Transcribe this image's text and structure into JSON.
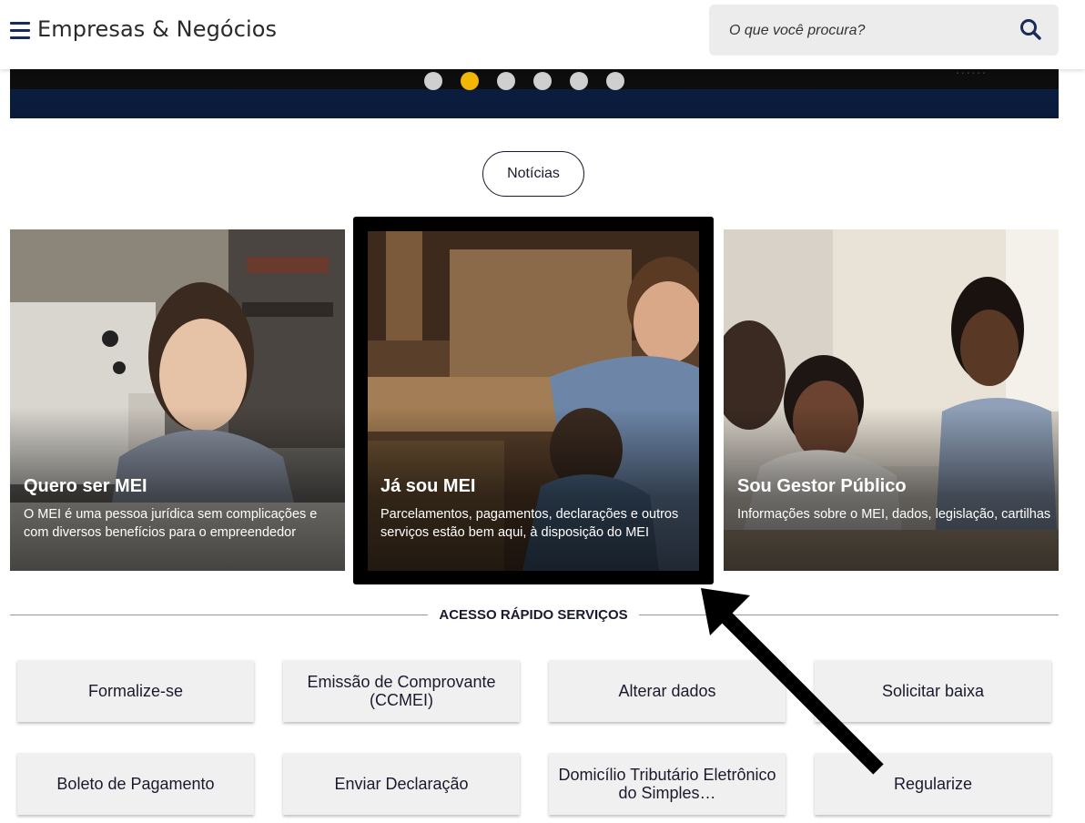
{
  "header": {
    "brand": "Empresas & Negócios",
    "search_placeholder": "O que você procura?"
  },
  "carousel": {
    "slide_count": 6,
    "active_index": 1
  },
  "news_button": "Notícias",
  "cards": [
    {
      "title": "Quero ser MEI",
      "desc": "O MEI é uma pessoa jurídica sem complicações e com diversos benefícios para o empreendedor"
    },
    {
      "title": "Já sou MEI",
      "desc": "Parcelamentos, pagamentos, declarações e outros serviços estão bem aqui, à disposição do MEI"
    },
    {
      "title": "Sou Gestor Público",
      "desc": "Informações sobre o MEI, dados, legislação, cartilhas"
    }
  ],
  "quick_access": {
    "title": "ACESSO RÁPIDO SERVIÇOS",
    "items": [
      "Formalize-se",
      "Emissão de Comprovante (CCMEI)",
      "Alterar dados",
      "Solicitar baixa",
      "Boleto de Pagamento",
      "Enviar Declaração",
      "Domicílio Tributário Eletrônico do Simples…",
      "Regularize"
    ]
  },
  "colors": {
    "accent": "#f2b705",
    "navy": "#1a2b5a",
    "banner_blue": "#0b1d3f"
  },
  "icons": {
    "menu": "hamburger-icon",
    "search": "search-icon",
    "annotation": "arrow-annotation"
  }
}
